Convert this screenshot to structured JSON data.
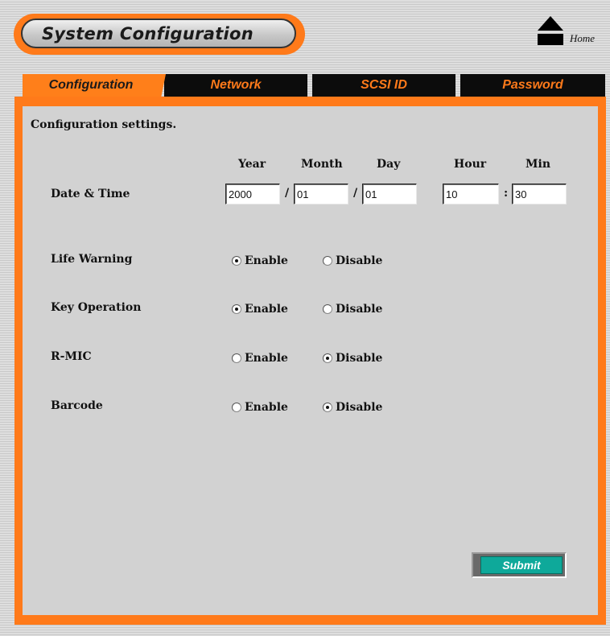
{
  "header": {
    "title": "System Configuration",
    "home_label": "Home",
    "accent_color": "#ff7a1a"
  },
  "tabs": [
    {
      "label": "Configuration",
      "active": true
    },
    {
      "label": "Network",
      "active": false
    },
    {
      "label": "SCSI ID",
      "active": false
    },
    {
      "label": "Password",
      "active": false
    }
  ],
  "main": {
    "section_title": "Configuration settings.",
    "datetime": {
      "label": "Date & Time",
      "headers": {
        "year": "Year",
        "month": "Month",
        "day": "Day",
        "hour": "Hour",
        "min": "Min"
      },
      "values": {
        "year": "2000",
        "month": "01",
        "day": "01",
        "hour": "10",
        "min": "30"
      },
      "date_separator": "/",
      "time_separator": ":"
    },
    "settings": [
      {
        "label": "Life Warning",
        "enable_label": "Enable",
        "disable_label": "Disable",
        "selected": "Enable"
      },
      {
        "label": "Key Operation",
        "enable_label": "Enable",
        "disable_label": "Disable",
        "selected": "Enable"
      },
      {
        "label": "R-MIC",
        "enable_label": "Enable",
        "disable_label": "Disable",
        "selected": "Disable"
      },
      {
        "label": "Barcode",
        "enable_label": "Enable",
        "disable_label": "Disable",
        "selected": "Disable"
      }
    ],
    "submit_label": "Submit"
  }
}
